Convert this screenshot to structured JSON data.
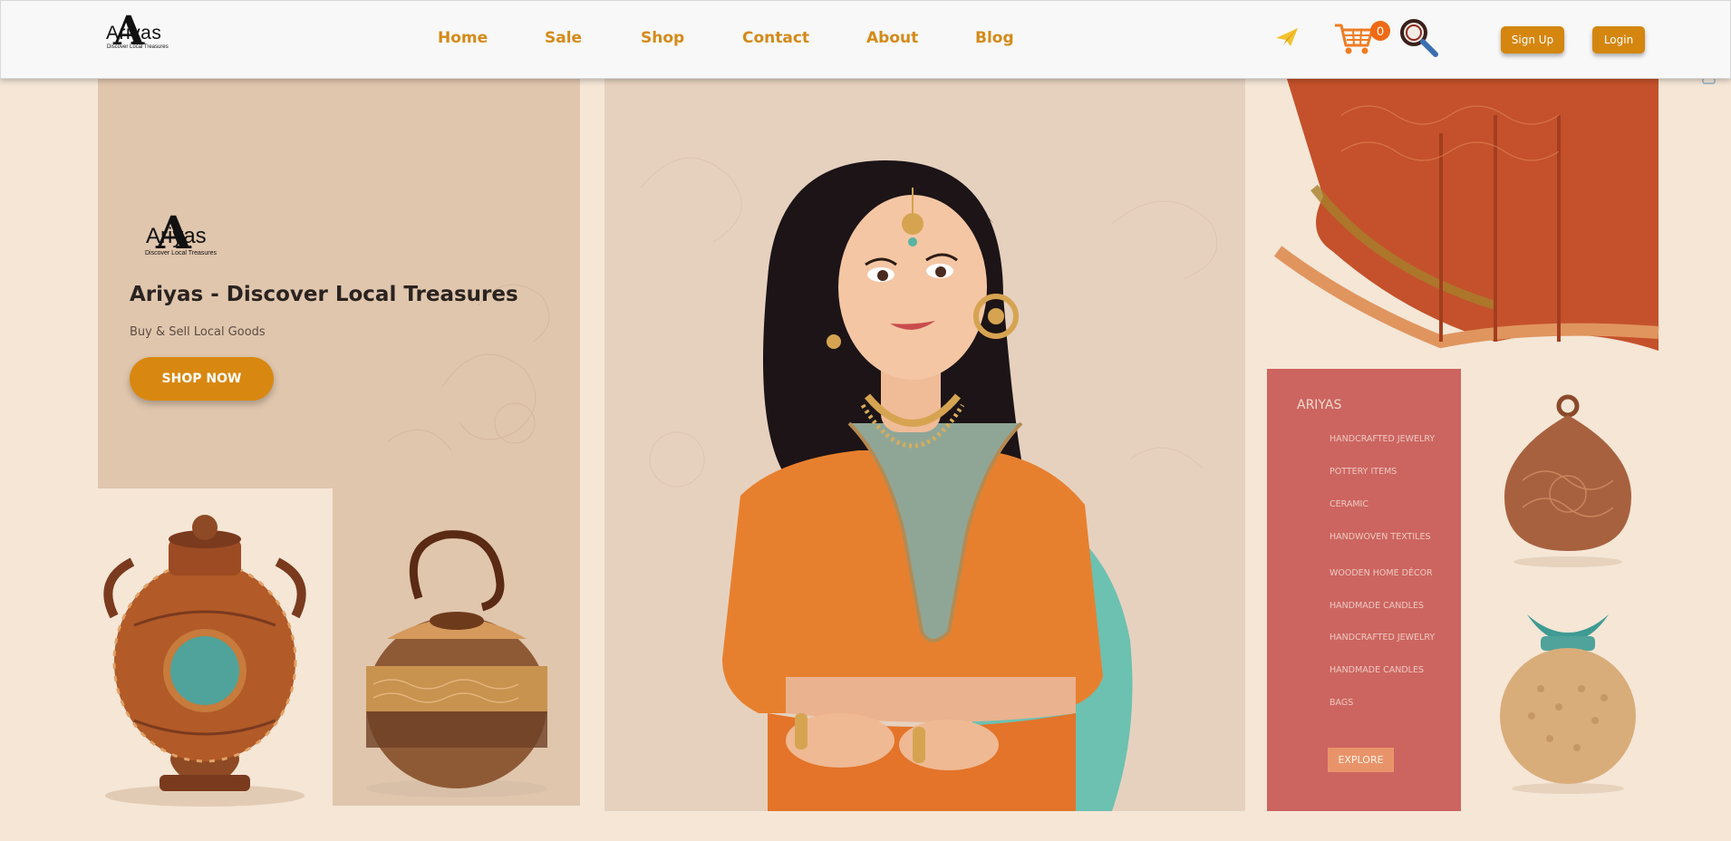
{
  "header": {
    "logo": {
      "letter": "A",
      "word": "Ariyas",
      "tagline": "Discover Local Treasures"
    },
    "nav": [
      {
        "label": "Home"
      },
      {
        "label": "Sale"
      },
      {
        "label": "Shop"
      },
      {
        "label": "Contact"
      },
      {
        "label": "About"
      },
      {
        "label": "Blog"
      }
    ],
    "icons": [
      "paper-plane-icon",
      "cart-icon",
      "search-icon"
    ],
    "cart_count": "0",
    "signup_label": "Sign Up",
    "login_label": "Login"
  },
  "hero": {
    "logo": {
      "letter": "A",
      "word": "Ariyas",
      "tagline": "Discover Local Treasures"
    },
    "title": "Ariyas - Discover Local Treasures",
    "subtitle": "Buy & Sell Local Goods",
    "cta_label": "SHOP NOW"
  },
  "categories": {
    "title": "ARIYAS",
    "items": [
      "HANDCRAFTED JEWELRY",
      "POTTERY ITEMS",
      "CERAMIC",
      "HANDWOVEN TEXTILES",
      "WOODEN HOME DÉCOR",
      "HANDMADE CANDLES",
      "HANDCRAFTED JEWELRY",
      "HANDMADE CANDLES",
      "BAGS"
    ],
    "explore_label": "EXPLORE"
  },
  "colors": {
    "accent": "#d4860f",
    "nav_text": "#d48a19",
    "background": "#f5e6d6",
    "panel": "#e0c6ad",
    "category_panel": "#cc6560",
    "badge": "#ef6a15"
  }
}
